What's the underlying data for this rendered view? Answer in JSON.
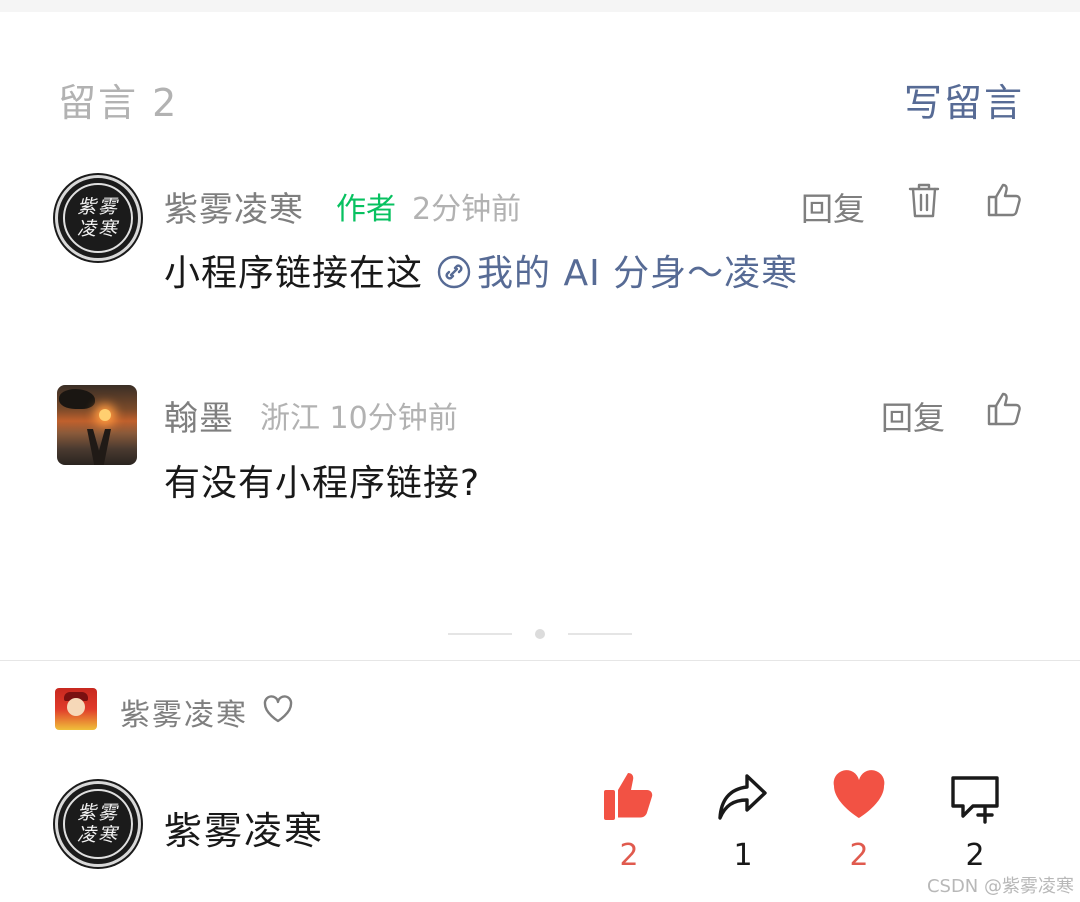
{
  "header": {
    "comments_title": "留言 2",
    "write_comment": "写留言"
  },
  "comments": [
    {
      "name": "紫雾凌寒",
      "badge": "作者",
      "meta": "2分钟前",
      "reply": "回复",
      "text": "小程序链接在这",
      "link_text": "我的 AI 分身～凌寒",
      "avatar_glyphs": [
        "紫雾",
        "凌寒"
      ]
    },
    {
      "name": "翰墨",
      "meta": "浙江 10分钟前",
      "reply": "回复",
      "text": "有没有小程序链接?"
    }
  ],
  "footer": {
    "small_author": "紫雾凌寒",
    "author": "紫雾凌寒",
    "author_glyphs": [
      "紫雾",
      "凌寒"
    ],
    "actions": [
      {
        "icon": "thumbs-up-filled-icon",
        "count": "2",
        "active": true
      },
      {
        "icon": "share-icon",
        "count": "1",
        "active": false
      },
      {
        "icon": "heart-filled-icon",
        "count": "2",
        "active": true
      },
      {
        "icon": "comment-add-icon",
        "count": "2",
        "active": false
      }
    ]
  },
  "watermark": "CSDN @紫雾凌寒",
  "colors": {
    "link": "#576b95",
    "author_badge": "#07c160",
    "active_red": "#f25244"
  }
}
